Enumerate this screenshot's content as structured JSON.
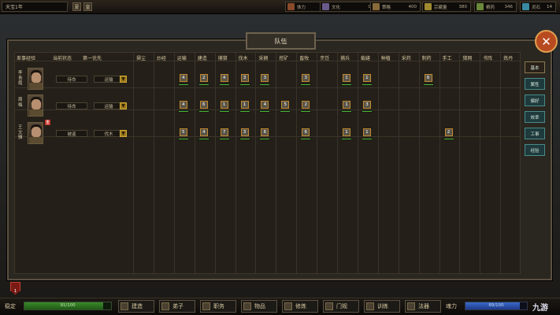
{
  "topbar": {
    "date": "天宝1年",
    "btn_a": "夏",
    "btn_b": "皇",
    "resources": [
      {
        "icon": "health-icon",
        "label": "体力",
        "value": "0",
        "color": "#8a4a2a"
      },
      {
        "icon": "culture-icon",
        "label": "文化",
        "value": "0",
        "color": "#6a5a8a"
      },
      {
        "icon": "strategy-icon",
        "label": "策略",
        "value": "400",
        "color": "#8a6a3a"
      },
      {
        "icon": "treasury-icon",
        "label": "宗藏量",
        "value": "380",
        "color": "#a08a30"
      },
      {
        "icon": "grain-icon",
        "label": "粮药",
        "value": "346",
        "color": "#6a8a3a"
      },
      {
        "icon": "spirit-stone-icon",
        "label": "灵石",
        "value": "14",
        "color": "#3a8aa0"
      }
    ]
  },
  "dialog": {
    "title": "队伍",
    "close": "✕"
  },
  "columns": {
    "role": "差事经验",
    "status": "当前状态",
    "priority": "第一优先",
    "skills": [
      "掃尘",
      "炒经",
      "运输",
      "建造",
      "捕猎",
      "伐木",
      "采摘",
      "挖矿",
      "畜牧",
      "烹饪",
      "捕兵",
      "裁缝",
      "种植",
      "采药",
      "制药",
      "手工",
      "猎网",
      "书阵",
      "炼丹"
    ]
  },
  "members": [
    {
      "name": "李青霞",
      "status": "待命",
      "priority": "运输",
      "red_tag": "",
      "skills": [
        null,
        null,
        "4",
        "2",
        "4",
        "3",
        "3",
        null,
        "3",
        null,
        "1",
        "1",
        null,
        null,
        "6",
        null,
        null,
        null,
        null
      ]
    },
    {
      "name": "周梅",
      "status": "待命",
      "priority": "运输",
      "red_tag": "",
      "skills": [
        null,
        null,
        "4",
        "6",
        "1",
        "1",
        "4",
        "5",
        "2",
        null,
        "1",
        "3",
        null,
        null,
        null,
        null,
        null,
        null,
        null
      ]
    },
    {
      "name": "王文雅",
      "status": "被盗",
      "priority": "伐木",
      "red_tag": "重",
      "skills": [
        null,
        null,
        "5",
        "4",
        "7",
        "3",
        "6",
        null,
        "6",
        null,
        "1",
        "1",
        null,
        null,
        null,
        "2",
        null,
        null,
        null
      ]
    }
  ],
  "side_tabs": [
    "基本",
    "属性",
    "偏好",
    "效率",
    "工事",
    "经验"
  ],
  "badge": "1",
  "bottom": {
    "stability_label": "稳定",
    "stability_text": "91/100",
    "stability_pct": 0.91,
    "menu": [
      "建造",
      "弟子",
      "职务",
      "物品",
      "修炼",
      "门规",
      "训练",
      "法器"
    ],
    "soul_label": "魂力",
    "soul_text": "89/100",
    "soul_pct": 0.89,
    "logo": "九游"
  }
}
